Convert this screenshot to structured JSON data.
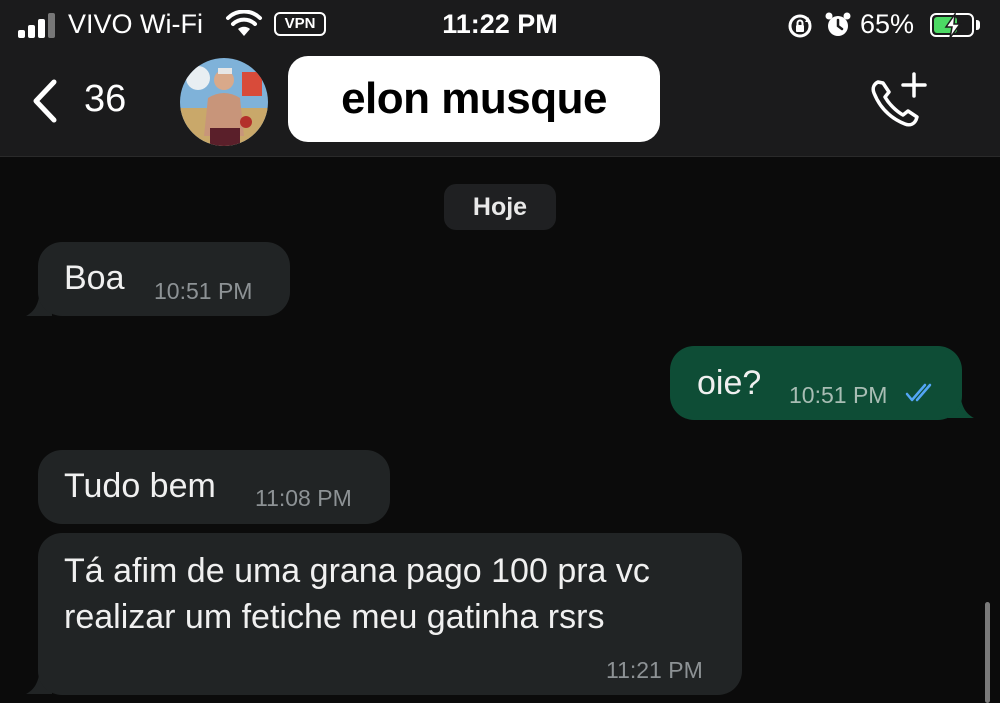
{
  "status_bar": {
    "carrier": "VIVO Wi-Fi",
    "vpn": "VPN",
    "time": "11:22 PM",
    "battery_percent": "65%",
    "battery_level": 0.65,
    "battery_color": "#4cd964",
    "icons": [
      "signal-icon",
      "wifi-icon",
      "orientation-lock-icon",
      "alarm-icon",
      "battery-charging-icon"
    ]
  },
  "header": {
    "back_count": "36",
    "contact_name": "elon musque",
    "icons": [
      "back-chevron-icon",
      "add-call-icon"
    ]
  },
  "chat": {
    "date_divider": "Hoje",
    "messages": [
      {
        "direction": "incoming",
        "text": "Boa",
        "time": "10:51 PM"
      },
      {
        "direction": "outgoing",
        "text": "oie?",
        "time": "10:51 PM",
        "status": "read"
      },
      {
        "direction": "incoming",
        "text": "Tudo bem",
        "time": "11:08 PM"
      },
      {
        "direction": "incoming",
        "lines": [
          "Tá afim de uma grana pago 100 pra vc",
          "realizar um fetiche meu gatinha rsrs"
        ],
        "time": "11:21 PM"
      }
    ],
    "colors": {
      "incoming_bubble": "#212425",
      "outgoing_bubble": "#0e4d36",
      "read_ticks": "#53a6f5",
      "background": "#0b0b0b"
    }
  }
}
